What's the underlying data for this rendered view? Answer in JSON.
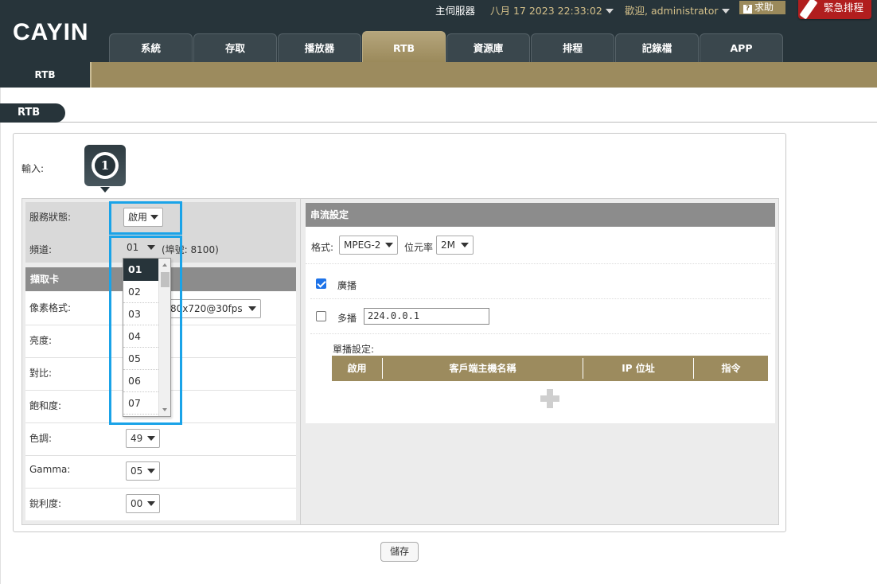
{
  "header": {
    "logo": "CAYIN",
    "server": "主伺服器",
    "datetime": "八月 17 2023 22:33:02",
    "welcome": "歡迎, administrator",
    "help": "求助",
    "emergency": "緊急排程",
    "tabs": [
      {
        "label": "系統"
      },
      {
        "label": "存取"
      },
      {
        "label": "播放器"
      },
      {
        "label": "RTB"
      },
      {
        "label": "資源庫"
      },
      {
        "label": "排程"
      },
      {
        "label": "記錄檔"
      },
      {
        "label": "APP"
      }
    ],
    "active_tab": "RTB"
  },
  "subnav": {
    "tab": "RTB"
  },
  "page": {
    "title": "RTB"
  },
  "input": {
    "label": "輸入:",
    "number": "1"
  },
  "service": {
    "status_label": "服務狀態:",
    "status_value": "啟用",
    "channel_label": "頻道:",
    "channel_value": "01",
    "port_hint": "(埠號: 8100)"
  },
  "channel_options": [
    "01",
    "02",
    "03",
    "04",
    "05",
    "06",
    "07"
  ],
  "capture": {
    "header": "擷取卡",
    "pixel_format_label": "像素格式:",
    "pixel_format_value": "1280x720@30fps",
    "pixel_format_visible": "80x720@30fps",
    "brightness_label": "亮度:",
    "contrast_label": "對比:",
    "saturation_label": "飽和度:",
    "hue_label": "色調:",
    "hue_value": "49",
    "gamma_label": "Gamma:",
    "gamma_value": "05",
    "sharpness_label": "銳利度:",
    "sharpness_value": "00"
  },
  "stream": {
    "header": "串流設定",
    "format_label": "格式:",
    "format_value": "MPEG-2",
    "bitrate_label": "位元率",
    "bitrate_value": "2M",
    "broadcast_label": "廣播",
    "broadcast_checked": true,
    "multicast_label": "多播",
    "multicast_checked": false,
    "multicast_ip": "224.0.0.1",
    "unicast_label": "單播設定:",
    "table_headers": [
      "啟用",
      "客戶端主機名稱",
      "IP 位址",
      "指令"
    ]
  },
  "footer": {
    "save": "儲存"
  },
  "colors": {
    "dark": "#27343a",
    "gold": "#9c8b5e",
    "highlight": "#1aa3e8",
    "emergency": "#b11e1e"
  }
}
